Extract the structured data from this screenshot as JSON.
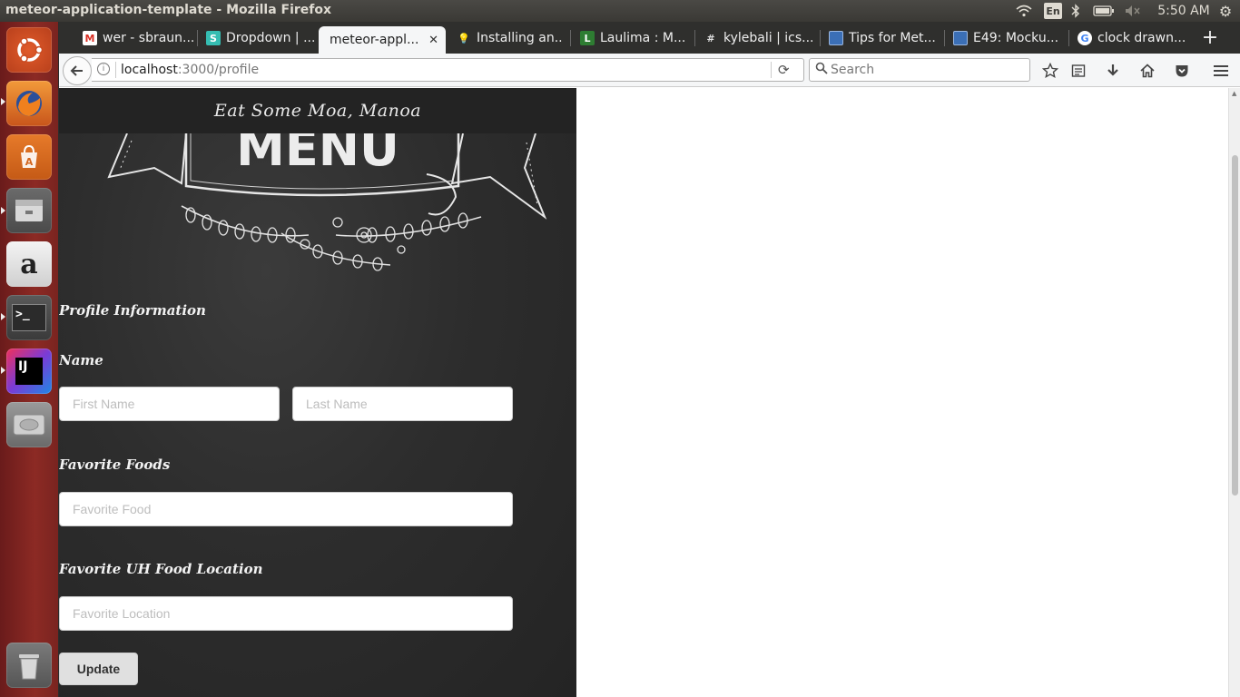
{
  "window": {
    "title": "meteor-application-template - Mozilla Firefox"
  },
  "tray": {
    "lang": "En",
    "clock": "5:50 AM",
    "icons": [
      "wifi-icon",
      "bluetooth-icon",
      "battery-icon",
      "volume-muted-icon",
      "settings-gear-icon"
    ]
  },
  "launcher": {
    "items": [
      "ubuntu-dash",
      "firefox",
      "software-center",
      "files",
      "amazon",
      "terminal",
      "intellij-idea",
      "disk-drive",
      "trash"
    ],
    "amazon_glyph": "a",
    "terminal_glyph": ">_",
    "intellij_glyph": "IJ"
  },
  "tabs": [
    {
      "label": "wer - sbraun...",
      "favicon": "M"
    },
    {
      "label": "Dropdown | ...",
      "favicon": "S"
    },
    {
      "label": "meteor-appl...",
      "favicon": "",
      "active": true
    },
    {
      "label": "Installing an...",
      "favicon": "💡"
    },
    {
      "label": "Laulima : M...",
      "favicon": "L"
    },
    {
      "label": "kylebali | ics...",
      "favicon": "#"
    },
    {
      "label": "Tips for Met...",
      "favicon": ""
    },
    {
      "label": "E49: Mocku...",
      "favicon": ""
    },
    {
      "label": "clock drawn...",
      "favicon": "G"
    }
  ],
  "navbar": {
    "url_host": "localhost",
    "url_path": ":3000/profile",
    "search_placeholder": "Search"
  },
  "page": {
    "site_title": "Eat Some Moa, Manoa",
    "banner_text": "MENU",
    "section_title": "Profile Information",
    "name_label": "Name",
    "first_name_placeholder": "First Name",
    "last_name_placeholder": "Last Name",
    "food_label": "Favorite Foods",
    "food_placeholder": "Favorite Food",
    "location_label": "Favorite UH Food Location",
    "location_placeholder": "Favorite Location",
    "update_button": "Update"
  },
  "colors": {
    "launcher_bg": "#8c2a24",
    "chalkboard": "#2d2d2d",
    "header_bg": "#232323"
  }
}
